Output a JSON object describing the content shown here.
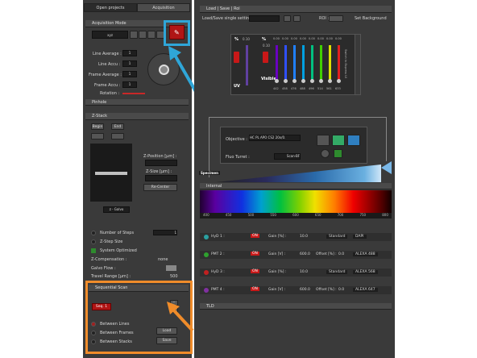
{
  "tabs": {
    "open_projects": "Open projects",
    "acquisition": "Acquisition"
  },
  "acq_mode": {
    "title": "Acquisition Mode",
    "mode_value": "xyz"
  },
  "averages": {
    "line_average": "Line Average :",
    "line_average_val": "1",
    "line_accu": "Line Accu :",
    "line_accu_val": "1",
    "frame_average": "Frame Average :",
    "frame_average_val": "1",
    "frame_accu": "Frame Accu :",
    "frame_accu_val": "1",
    "rotation": "Rotation :",
    "pinhole": "Pinhole"
  },
  "zstack": {
    "title": "Z-Stack",
    "begin": "Begin",
    "end": "End",
    "zpos_label": "Z-Position [µm] :",
    "zsize_label": "Z-Size [µm] :",
    "recenter": "Re-Center",
    "galvo": "z - Galvo",
    "num_steps": "Number of Steps",
    "num_steps_val": "1",
    "step_size": "Z-Step Size",
    "system_opt": "System Optimized",
    "zcomp": "Z-Compensation :",
    "zcomp_val": "none",
    "galvo_flow": "Galvo Flow :",
    "travel": "Travel Range [µm] :",
    "travel_val": "500"
  },
  "seq": {
    "title": "Sequential Scan",
    "seq1": "Seq. 1",
    "between_lines": "Between Lines",
    "between_frames": "Between Frames",
    "between_stacks": "Between Stacks",
    "load": "Load",
    "save": "Save"
  },
  "toolbar": {
    "title": "Load | Save | Roi",
    "load_single": "Load/Save single setting :",
    "roi": "ROI :",
    "set_background": "Set Background"
  },
  "lasers": {
    "uv_label": "UV",
    "visible_label": "Visible",
    "percent": "%",
    "uv_value": "0.10",
    "visible_value": "0.10",
    "values": [
      "0.00",
      "0.00",
      "0.00",
      "0.00",
      "0.00",
      "0.00",
      "0.00",
      "0.00"
    ],
    "wavelengths": [
      "442",
      "458",
      "476",
      "488",
      "496",
      "514",
      "561",
      "633"
    ],
    "side_label": "Switch to Express UI",
    "on": "ON"
  },
  "objective": {
    "label": "Objective :",
    "value": "HC PL APO CS2   20x/0.",
    "turret": "Fluo Turret :",
    "turret_val": "Scan-BF"
  },
  "specimen": "Specimen",
  "internal": {
    "title": "Internal",
    "ticks": [
      "400",
      "450",
      "500",
      "550",
      "600",
      "650",
      "700",
      "750",
      "800"
    ]
  },
  "detectors": [
    {
      "name": "HyD 1 :",
      "gain_label": "Gain [%] :",
      "gain": "10.0",
      "mode": "Standard",
      "dye": "DAPI"
    },
    {
      "name": "PMT 2 :",
      "gain_label": "Gain [V] :",
      "gain": "600.0",
      "offset_label": "Offset [%] :",
      "offset": "0.0",
      "dye": "ALEXA 488"
    },
    {
      "name": "HyD 3 :",
      "gain_label": "Gain [%] :",
      "gain": "10.0",
      "mode": "Standard",
      "dye": "ALEXA 568"
    },
    {
      "name": "PMT 4 :",
      "gain_label": "Gain [V] :",
      "gain": "600.0",
      "offset_label": "Offset [%] :",
      "offset": "0.0",
      "dye": "ALEXA 647"
    }
  ],
  "tld": "TLD",
  "colors": {
    "highlight_blue": "#2fa6d8",
    "highlight_orange": "#f08c2a",
    "laser_red": "#c81818"
  }
}
